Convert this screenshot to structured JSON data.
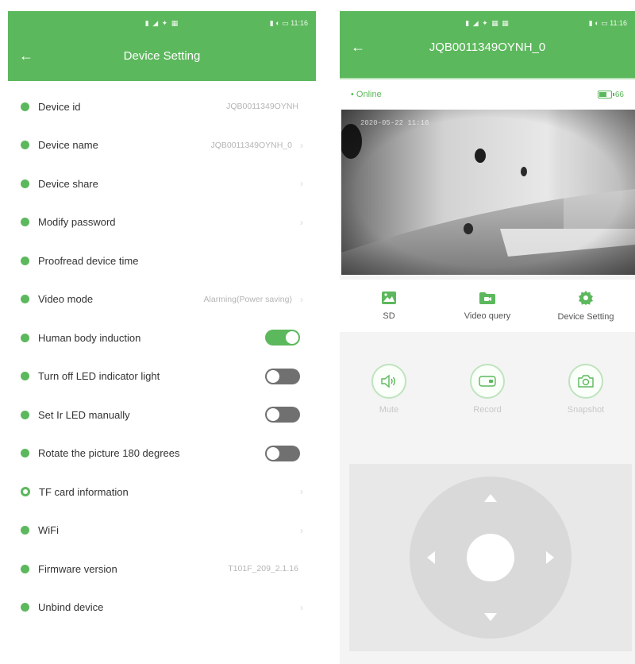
{
  "colors": {
    "accent": "#5cb85c",
    "toggle_off": "#707070",
    "light_text": "#b5b5b5"
  },
  "left": {
    "status": {
      "center": "▮ ◢ ✦ ▦",
      "right": "▮ ◐ ▭ 11:16"
    },
    "title": "Device Setting",
    "settings": [
      {
        "label": "Device id",
        "value": "JQB0011349OYNH"
      },
      {
        "label": "Device name",
        "value": "JQB0011349OYNH_0"
      },
      {
        "label": "Device share"
      },
      {
        "label": "Modify password"
      },
      {
        "label": "Proofread device time"
      },
      {
        "label": "Video mode",
        "value": "Alarming(Power saving)"
      },
      {
        "label": "Human body induction",
        "toggle": "on"
      },
      {
        "label": "Turn off LED indicator light",
        "toggle": "off"
      },
      {
        "label": "Set Ir LED manually",
        "toggle": "off"
      },
      {
        "label": "Rotate the picture 180 degrees",
        "toggle": "off"
      },
      {
        "label": "TF card information"
      },
      {
        "label": "WiFi"
      },
      {
        "label": "Firmware version",
        "value": "T101F_209_2.1.16"
      },
      {
        "label": "Unbind device"
      }
    ]
  },
  "right": {
    "status": {
      "center": "▮ ◢ ✦ ▦ ▦",
      "right": "▮ ◐ ▭ 11:16"
    },
    "title": "JQB0011349OYNH_0",
    "online": "• Online",
    "battery": "66",
    "video_timestamp": "2020-05-22 11:16",
    "actions": [
      {
        "label": "SD",
        "icon": "sd-card-icon"
      },
      {
        "label": "Video query",
        "icon": "video-folder-icon"
      },
      {
        "label": "Device Setting",
        "icon": "gear-icon"
      }
    ],
    "controls": [
      {
        "label": "Mute",
        "icon": "speaker-icon"
      },
      {
        "label": "Record",
        "icon": "record-icon"
      },
      {
        "label": "Snapshot",
        "icon": "camera-icon"
      }
    ]
  }
}
